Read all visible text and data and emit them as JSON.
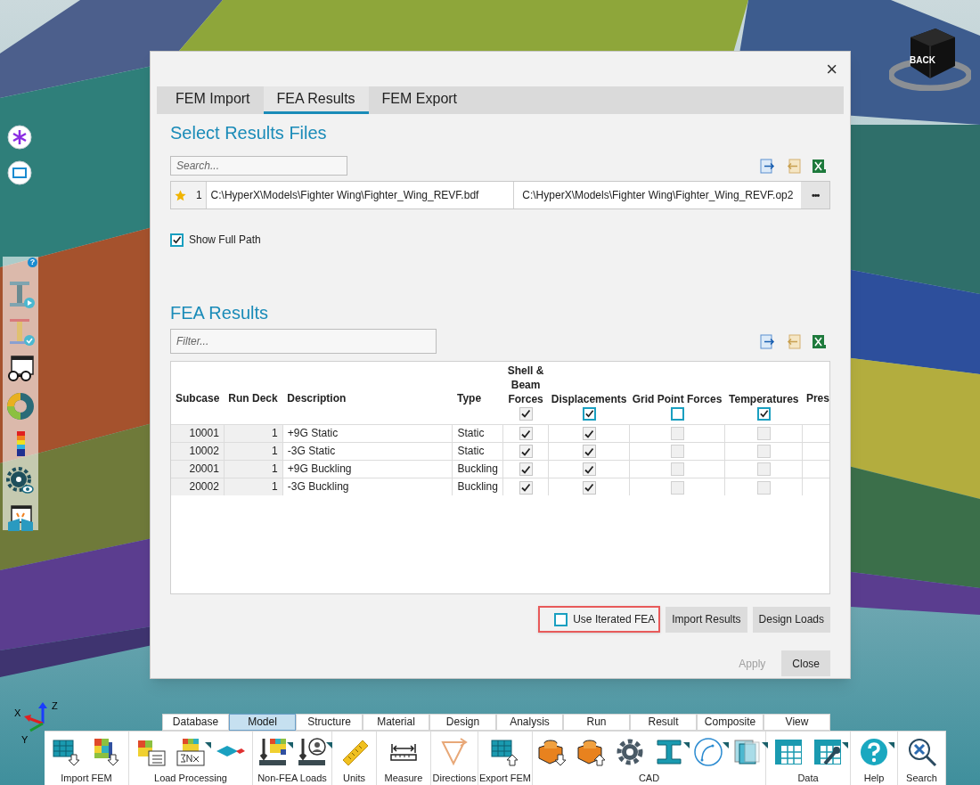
{
  "view_cube": {
    "face": "BACK"
  },
  "axis_triad": {
    "labels": [
      "X",
      "Y",
      "Z"
    ]
  },
  "side_toolbar": {
    "help": "?"
  },
  "dialog": {
    "close": "×",
    "tabs": [
      {
        "label": "FEM Import",
        "selected": false
      },
      {
        "label": "FEA Results",
        "selected": true
      },
      {
        "label": "FEM Export",
        "selected": false
      }
    ],
    "files_section": {
      "title": "Select Results Files",
      "search_placeholder": "Search...",
      "files": [
        {
          "favorite": true,
          "index": "1",
          "fem_path": "C:\\HyperX\\Models\\Fighter Wing\\Fighter_Wing_REVF.bdf",
          "results_path": "C:\\HyperX\\Models\\Fighter Wing\\Fighter_Wing_REVF.op2",
          "browse": "•••"
        }
      ],
      "show_full_path": {
        "label": "Show Full Path",
        "checked": true
      }
    },
    "results_section": {
      "title": "FEA Results",
      "filter_placeholder": "Filter...",
      "table": {
        "columns": [
          {
            "label": "Subcase"
          },
          {
            "label": "Run Deck"
          },
          {
            "label": "Description"
          },
          {
            "label": "Type"
          },
          {
            "label": "Shell & Beam Forces",
            "check": {
              "checked": true,
              "enabled": false
            }
          },
          {
            "label": "Displacements",
            "check": {
              "checked": true,
              "enabled": true
            }
          },
          {
            "label": "Grid Point Forces",
            "check": {
              "checked": false,
              "enabled": true
            }
          },
          {
            "label": "Temperatures",
            "check": {
              "checked": true,
              "enabled": true
            }
          },
          {
            "label": "Pres"
          }
        ],
        "rows": [
          {
            "subcase": "10001",
            "run_deck": "1",
            "description": "+9G Static",
            "type": "Static",
            "checks": [
              {
                "checked": true
              },
              {
                "checked": true
              },
              {
                "checked": false
              },
              {
                "checked": false
              }
            ]
          },
          {
            "subcase": "10002",
            "run_deck": "1",
            "description": "-3G Static",
            "type": "Static",
            "checks": [
              {
                "checked": true
              },
              {
                "checked": true
              },
              {
                "checked": false
              },
              {
                "checked": false
              }
            ]
          },
          {
            "subcase": "20001",
            "run_deck": "1",
            "description": "+9G Buckling",
            "type": "Buckling",
            "checks": [
              {
                "checked": true
              },
              {
                "checked": true
              },
              {
                "checked": false
              },
              {
                "checked": false
              }
            ]
          },
          {
            "subcase": "20002",
            "run_deck": "1",
            "description": "-3G Buckling",
            "type": "Buckling",
            "checks": [
              {
                "checked": true
              },
              {
                "checked": true
              },
              {
                "checked": false
              },
              {
                "checked": false
              }
            ]
          }
        ]
      }
    },
    "use_iterated_fea": {
      "label": "Use Iterated FEA",
      "checked": false
    },
    "action_buttons": [
      {
        "label": "Import Results",
        "disabled": false
      },
      {
        "label": "Design Loads",
        "disabled": false
      }
    ],
    "footer_buttons": [
      {
        "label": "Apply",
        "disabled": true
      },
      {
        "label": "Close",
        "disabled": false
      }
    ]
  },
  "ribbon": {
    "tabs": [
      {
        "label": "Database",
        "selected": false
      },
      {
        "label": "Model",
        "selected": true
      },
      {
        "label": "Structure",
        "selected": false
      },
      {
        "label": "Material",
        "selected": false
      },
      {
        "label": "Design",
        "selected": false
      },
      {
        "label": "Analysis",
        "selected": false
      },
      {
        "label": "Run",
        "selected": false
      },
      {
        "label": "Result",
        "selected": false
      },
      {
        "label": "Composite",
        "selected": false
      },
      {
        "label": "View",
        "selected": false
      }
    ],
    "groups": [
      {
        "label": "Import FEM",
        "tools": [
          {
            "kind": "mesh-in",
            "menu": false
          },
          {
            "kind": "contour-in",
            "menu": false
          }
        ]
      },
      {
        "label": "Load Processing",
        "tools": [
          {
            "kind": "load-list",
            "menu": false
          },
          {
            "kind": "sum",
            "menu": true
          },
          {
            "kind": "diamond",
            "menu": false
          }
        ]
      },
      {
        "label": "Non-FEA Loads",
        "tools": [
          {
            "kind": "load-contour",
            "menu": true
          },
          {
            "kind": "load-person",
            "menu": true
          }
        ]
      },
      {
        "label": "Units",
        "tools": [
          {
            "kind": "ruler",
            "menu": false
          }
        ]
      },
      {
        "label": "Measure",
        "tools": [
          {
            "kind": "measure",
            "menu": false
          }
        ]
      },
      {
        "label": "Directions",
        "tools": [
          {
            "kind": "directions",
            "menu": false
          }
        ]
      },
      {
        "label": "Export FEM",
        "tools": [
          {
            "kind": "mesh-out",
            "menu": false
          }
        ]
      },
      {
        "label": "CAD",
        "tools": [
          {
            "kind": "cad-in",
            "menu": false
          },
          {
            "kind": "cad-out",
            "menu": false
          },
          {
            "kind": "gear",
            "menu": false
          },
          {
            "kind": "beam",
            "menu": true
          },
          {
            "kind": "curve",
            "menu": true
          },
          {
            "kind": "layers",
            "menu": true
          }
        ]
      },
      {
        "label": "Data",
        "tools": [
          {
            "kind": "table",
            "menu": false
          },
          {
            "kind": "table-edit",
            "menu": true
          }
        ]
      },
      {
        "label": "Help",
        "tools": [
          {
            "kind": "help",
            "menu": true
          }
        ]
      },
      {
        "label": "Search",
        "tools": [
          {
            "kind": "search",
            "menu": false
          }
        ]
      }
    ]
  }
}
